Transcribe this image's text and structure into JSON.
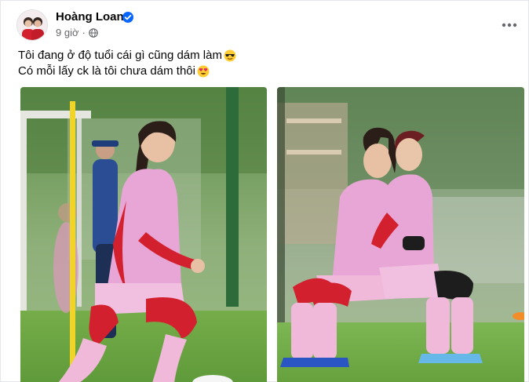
{
  "post": {
    "author": "Hoàng Loan",
    "timestamp": "9 giờ",
    "separator": "·",
    "caption_lines": [
      "Tôi đang ở độ tuổi cái gì cũng dám làm",
      "Có mỗi lấy ck là tôi chưa dám thôi"
    ],
    "emojis": [
      "sunglasses-face",
      "heart-eyes-face"
    ],
    "verified": true,
    "audience_icon": "globe-icon",
    "menu_icon": "more-options-icon"
  },
  "photos": [
    {
      "alt": "Player in pink training kit running on pitch"
    },
    {
      "alt": "Two players in pink kit doing a squat exercise"
    }
  ],
  "colors": {
    "accent": "#0866ff",
    "kit_pink": "#e8a6d6",
    "sleeve_red": "#d3202e",
    "grass": "#6fae45"
  }
}
